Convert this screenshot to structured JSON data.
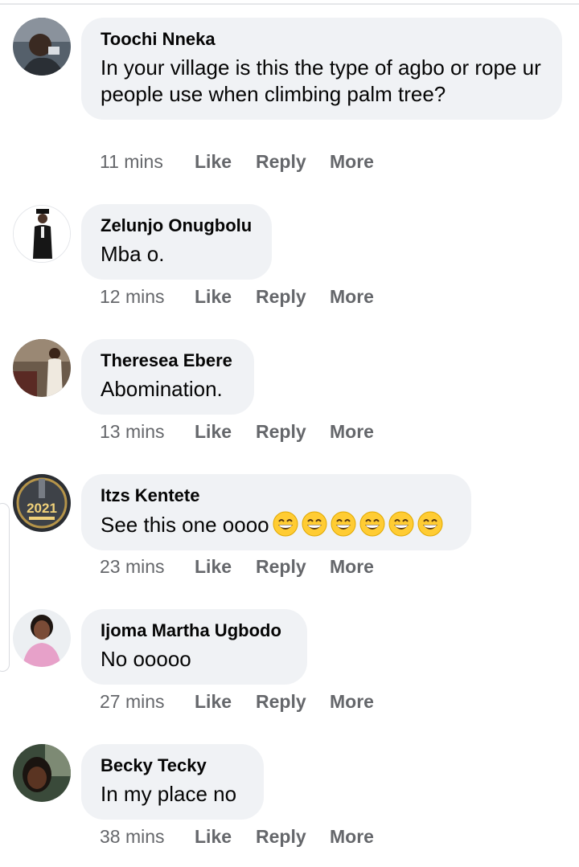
{
  "comments": [
    {
      "name": "Toochi Nneka",
      "text": "In your village is this the type of agbo or rope ur people use when climbing palm tree?",
      "time": "11 mins",
      "like": "Like",
      "reply": "Reply",
      "more": "More"
    },
    {
      "name": "Zelunjo Onugbolu",
      "text": "Mba o.",
      "time": "12 mins",
      "like": "Like",
      "reply": "Reply",
      "more": "More"
    },
    {
      "name": "Theresea Ebere",
      "text": "Abomination.",
      "time": "13 mins",
      "like": "Like",
      "reply": "Reply",
      "more": "More"
    },
    {
      "name": "Itzs Kentete",
      "text": "See this one oooo",
      "emoji_icons": [
        "grinning-face-emoji",
        "grinning-face-emoji",
        "grinning-face-emoji",
        "grinning-face-emoji",
        "grinning-face-emoji",
        "grinning-face-emoji"
      ],
      "time": "23 mins",
      "like": "Like",
      "reply": "Reply",
      "more": "More"
    },
    {
      "name": "Ijoma Martha Ugbodo",
      "text": "No ooooo",
      "time": "27 mins",
      "like": "Like",
      "reply": "Reply",
      "more": "More"
    },
    {
      "name": "Becky Tecky",
      "text": "In my place no",
      "time": "38 mins",
      "like": "Like",
      "reply": "Reply",
      "more": "More"
    }
  ],
  "avatar_badge": "2021",
  "colors": {
    "bubble": "#f0f2f5",
    "meta": "#65676b",
    "text": "#050505"
  }
}
